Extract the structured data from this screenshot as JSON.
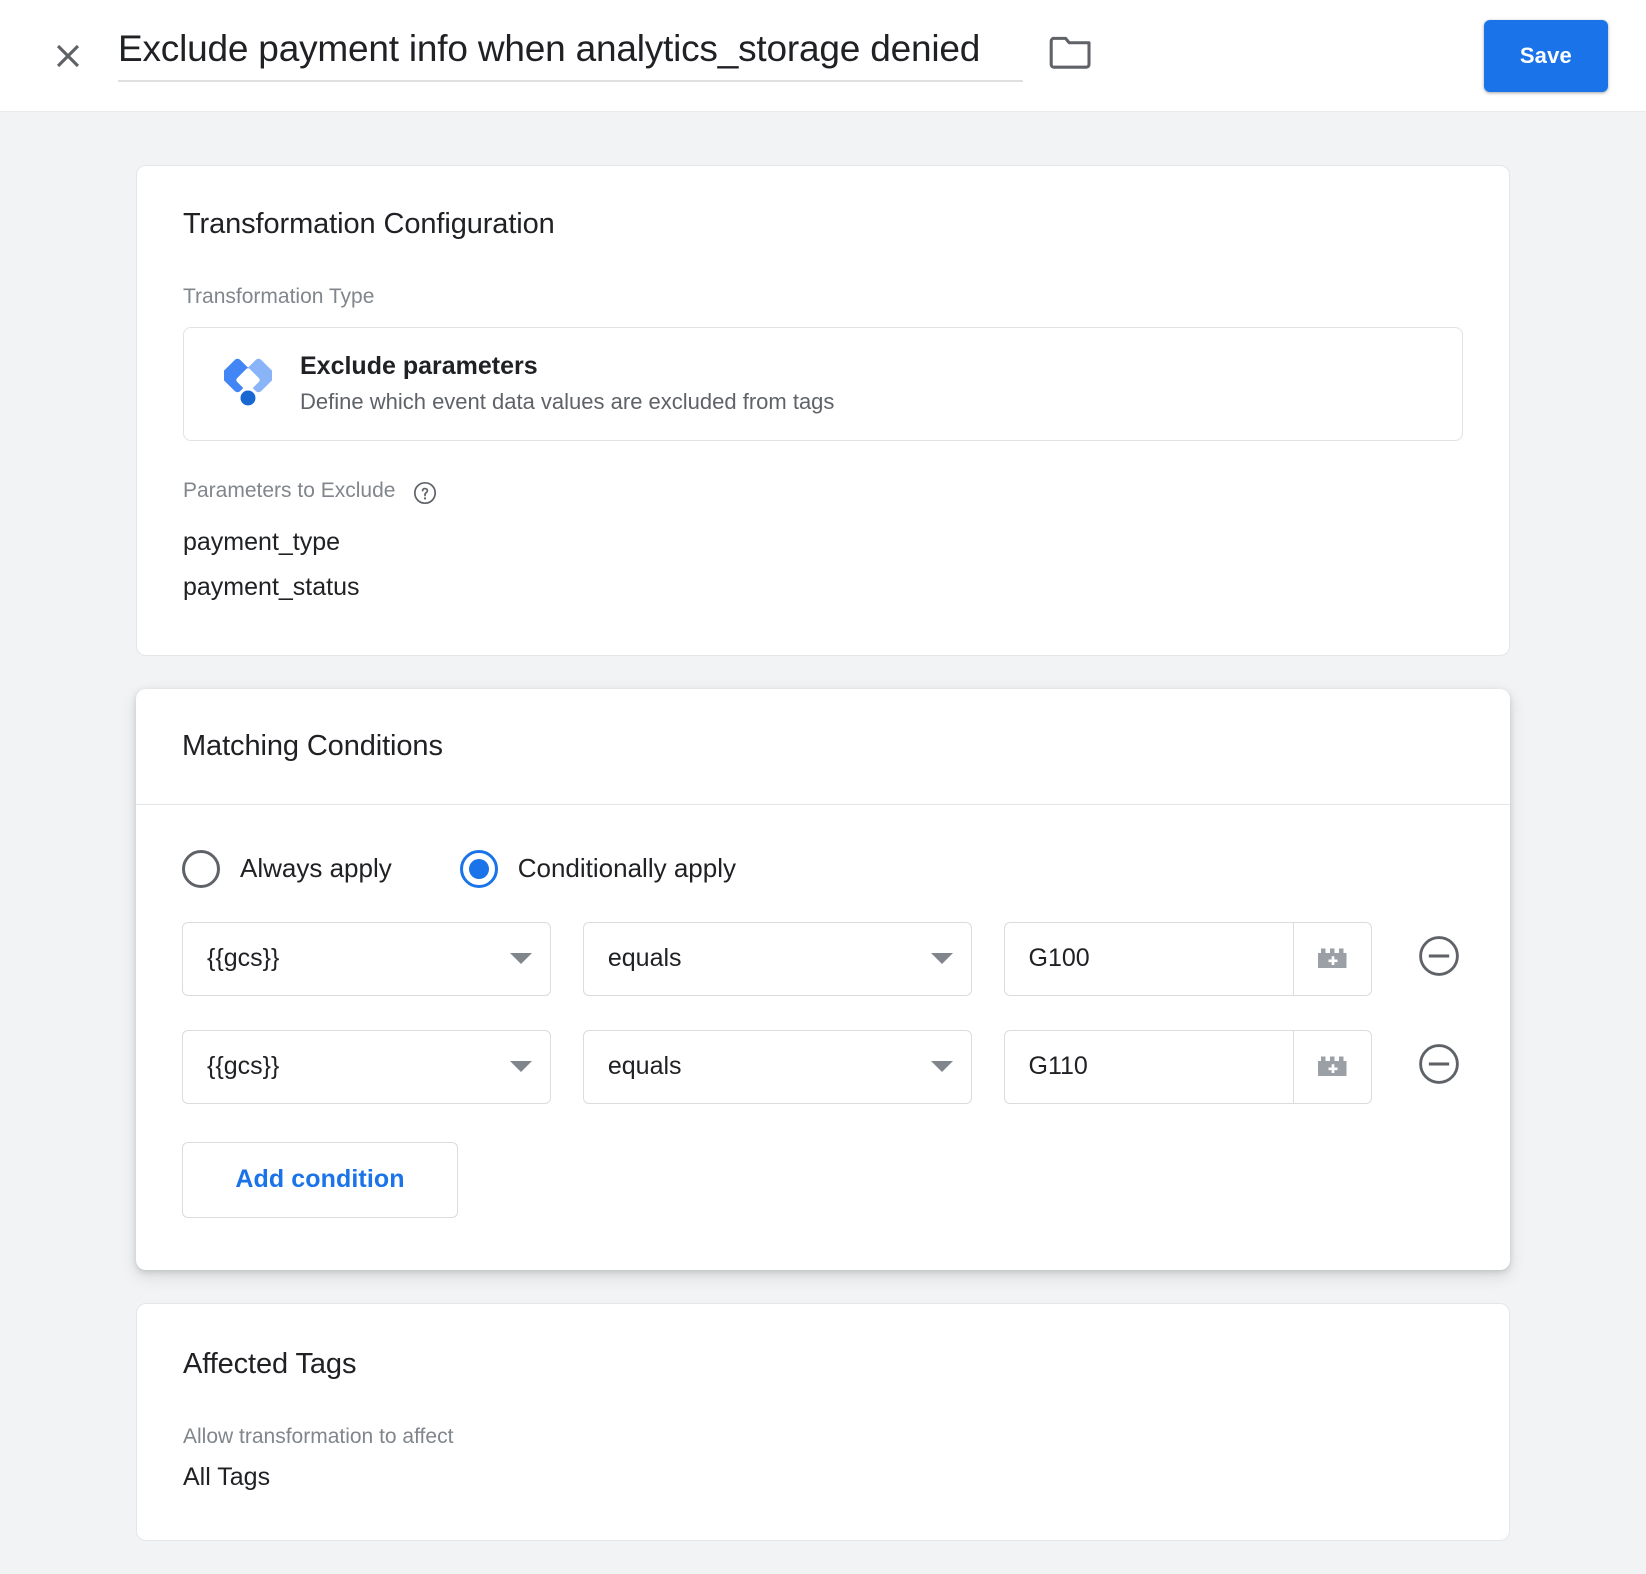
{
  "header": {
    "close_icon": "close-icon",
    "title": "Exclude payment info when analytics_storage denied",
    "folder_icon": "folder-icon",
    "save_label": "Save",
    "accent_color": "#1a73e8"
  },
  "transformation_card": {
    "title": "Transformation Configuration",
    "type_label": "Transformation Type",
    "type_tile": {
      "icon": "gtm-diamond-icon",
      "name": "Exclude parameters",
      "description": "Define which event data values are excluded from tags"
    },
    "parameters_label": "Parameters to Exclude",
    "parameters_help_icon": "help-circle-icon",
    "parameters": [
      "payment_type",
      "payment_status"
    ]
  },
  "matching_conditions_card": {
    "title": "Matching Conditions",
    "apply_mode": {
      "options": [
        {
          "label": "Always apply",
          "selected": false
        },
        {
          "label": "Conditionally apply",
          "selected": true
        }
      ]
    },
    "conditions": [
      {
        "variable": "{{gcs}}",
        "operator": "equals",
        "value": "G100",
        "variable_picker_icon": "chevron-down-icon",
        "operator_picker_icon": "chevron-down-icon",
        "value_picker_icon": "lego-brick-plus-icon",
        "remove_icon": "minus-circle-icon"
      },
      {
        "variable": "{{gcs}}",
        "operator": "equals",
        "value": "G110",
        "variable_picker_icon": "chevron-down-icon",
        "operator_picker_icon": "chevron-down-icon",
        "value_picker_icon": "lego-brick-plus-icon",
        "remove_icon": "minus-circle-icon"
      }
    ],
    "add_condition_label": "Add condition"
  },
  "affected_tags_card": {
    "title": "Affected Tags",
    "allow_label": "Allow transformation to affect",
    "allow_value": "All Tags"
  }
}
